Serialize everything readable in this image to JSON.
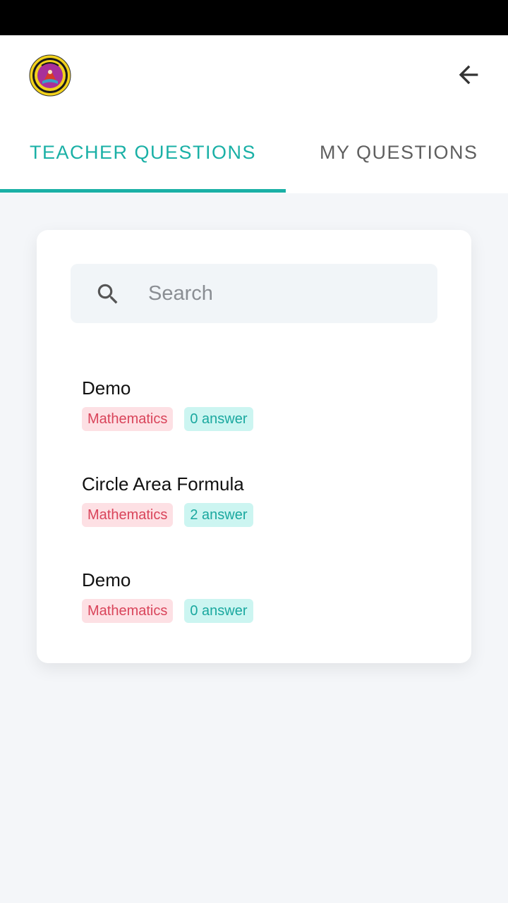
{
  "app_bar": {
    "logo_icon": "school-emblem-logo",
    "back_icon": "arrow-back-icon"
  },
  "tabs": [
    {
      "label": "TEACHER QUESTIONS",
      "active": true
    },
    {
      "label": "MY QUESTIONS",
      "active": false
    }
  ],
  "search": {
    "placeholder": "Search",
    "value": ""
  },
  "questions": [
    {
      "title": "Demo",
      "subject": "Mathematics",
      "answers": "0 answer"
    },
    {
      "title": "Circle Area Formula",
      "subject": "Mathematics",
      "answers": "2 answer"
    },
    {
      "title": "Demo",
      "subject": "Mathematics",
      "answers": "0 answer"
    }
  ],
  "colors": {
    "accent": "#1ab0a6",
    "subject_tag_bg": "#fde0e4",
    "subject_tag_text": "#d9445a",
    "answer_tag_bg": "#ccf5f1",
    "answer_tag_text": "#1aa89f"
  }
}
